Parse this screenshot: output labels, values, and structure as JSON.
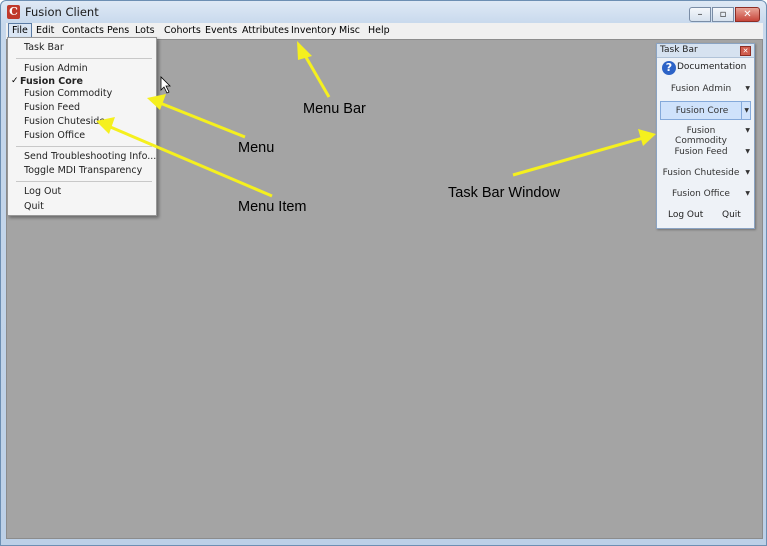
{
  "window": {
    "title": "Fusion Client",
    "app_icon": "C"
  },
  "window_buttons": {
    "minimize": "–",
    "maximize": "▫",
    "close": "✕"
  },
  "menubar": {
    "items": [
      "File",
      "Edit",
      "Contacts",
      "Pens",
      "Lots",
      "Cohorts",
      "Events",
      "Attributes",
      "Inventory",
      "Misc",
      "Help"
    ],
    "active": "File"
  },
  "file_menu": {
    "task_bar": "Task Bar",
    "fusion_admin": "Fusion Admin",
    "fusion_core": "Fusion Core",
    "fusion_core_check": "✓",
    "fusion_commodity": "Fusion Commodity",
    "fusion_feed": "Fusion Feed",
    "fusion_chuteside": "Fusion Chuteside",
    "fusion_office": "Fusion Office",
    "send_troubleshooting": "Send Troubleshooting Info...",
    "toggle_mdi": "Toggle MDI Transparency",
    "log_out": "Log Out",
    "quit": "Quit"
  },
  "taskbar_window": {
    "title": "Task Bar",
    "close": "✕",
    "documentation": "Documentation",
    "doc_icon": "?",
    "buttons": [
      "Fusion Admin",
      "Fusion Core",
      "Fusion Commodity",
      "Fusion Feed",
      "Fusion Chuteside",
      "Fusion Office"
    ],
    "arrow": "▼",
    "log_out": "Log Out",
    "quit": "Quit"
  },
  "annotations": {
    "menu_bar": "Menu Bar",
    "menu": "Menu",
    "menu_item": "Menu Item",
    "task_bar_window": "Task Bar Window"
  },
  "colors": {
    "arrow": "#f5f01e",
    "client_bg": "#a4a4a4"
  }
}
